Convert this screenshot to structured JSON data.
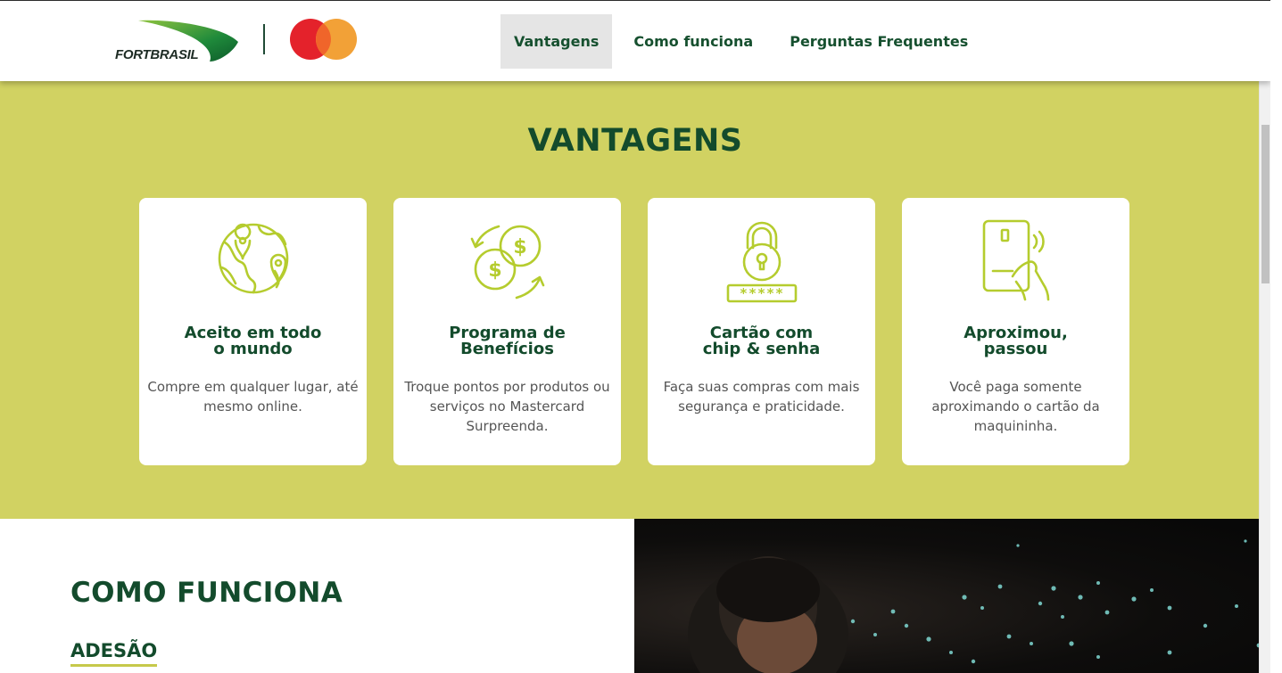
{
  "header": {
    "brand_name": "FORTBRASIL",
    "partner_logo": "mastercard-logo",
    "nav": [
      {
        "label": "Vantagens",
        "active": true
      },
      {
        "label": "Como funciona",
        "active": false
      },
      {
        "label": "Perguntas Frequentes",
        "active": false
      }
    ]
  },
  "vantagens": {
    "title": "VANTAGENS",
    "cards": [
      {
        "icon": "globe-location-icon",
        "title": "Aceito em todo\no mundo",
        "text": "Compre em qualquer lugar, até mesmo online."
      },
      {
        "icon": "coins-exchange-icon",
        "title": "Programa de\nBenefícios",
        "text": "Troque pontos por produtos ou serviços no Mastercard Surpreenda."
      },
      {
        "icon": "padlock-password-icon",
        "title": "Cartão com\nchip & senha",
        "text": "Faça suas compras com mais segurança e praticidade."
      },
      {
        "icon": "contactless-phone-icon",
        "title": "Aproximou,\npassou",
        "text": "Você paga somente aproximando o cartão da maquininha."
      }
    ]
  },
  "como_funciona": {
    "title": "COMO FUNCIONA",
    "subtitle": "ADESÃO"
  },
  "colors": {
    "brand_green": "#134b2c",
    "lime": "#d1d262",
    "icon_lime": "#b5cc2e",
    "mc_red": "#eb001b",
    "mc_orange": "#f79e1b"
  }
}
